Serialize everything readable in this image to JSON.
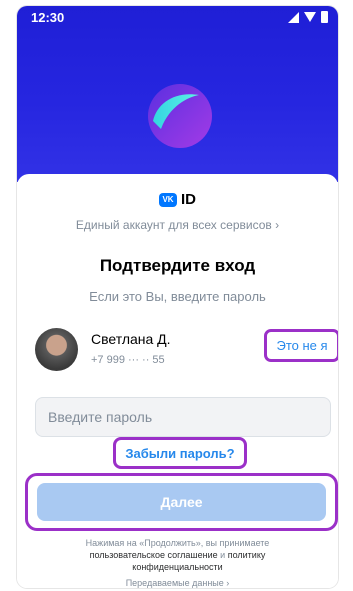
{
  "status_bar": {
    "time": "12:30"
  },
  "brand": {
    "badge": "VK",
    "name": "ID",
    "tagline": "Единый аккаунт для всех сервисов ›"
  },
  "login": {
    "title": "Подтвердите вход",
    "subtitle": "Если это Вы, введите пароль",
    "user": {
      "name": "Светлана Д.",
      "phone": "+7 999 ··· ·· 55"
    },
    "not_me": "Это не я",
    "password_placeholder": "Введите пароль",
    "forgot": "Забыли пароль?",
    "continue": "Далее"
  },
  "footer": {
    "terms_prefix": "Нажимая на «Продолжить», вы принимаете",
    "user_agreement": "пользовательское соглашение",
    "and": " и ",
    "privacy_line1": "политику",
    "privacy_line2": "конфиденциальности",
    "data_link": "Передаваемые данные ›"
  },
  "colors": {
    "accent": "#2688eb",
    "highlight": "#9b30c8",
    "hero": "#2626e0"
  }
}
